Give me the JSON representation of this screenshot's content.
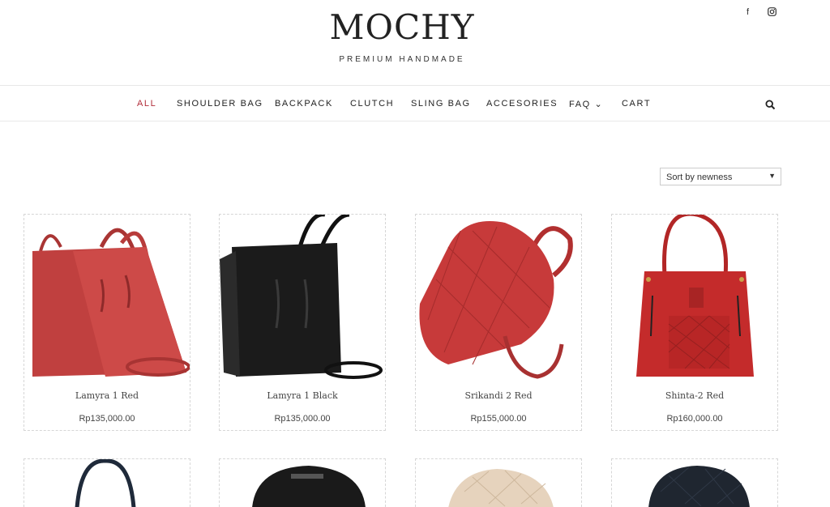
{
  "brand": {
    "name": "MOCHY",
    "tagline": "PREMIUM HANDMADE"
  },
  "social": [
    {
      "icon": "facebook-icon",
      "glyph": "f"
    },
    {
      "icon": "instagram-icon",
      "glyph": "◙"
    }
  ],
  "nav": {
    "items": [
      {
        "label": "ALL",
        "active": true
      },
      {
        "label": "SHOULDER BAG"
      },
      {
        "label": "BACKPACK"
      },
      {
        "label": "CLUTCH"
      },
      {
        "label": "SLING BAG"
      },
      {
        "label": "ACCESORIES"
      },
      {
        "label": "FAQ ⌄"
      },
      {
        "label": "CART"
      }
    ],
    "search_icon": "search-icon"
  },
  "sort": {
    "selected": "Sort by newness"
  },
  "products": [
    {
      "name": "Lamyra 1 Red",
      "price": "Rp135,000.00",
      "color": "#c0403f"
    },
    {
      "name": "Lamyra 1 Black",
      "price": "Rp135,000.00",
      "color": "#1b1b1b"
    },
    {
      "name": "Srikandi 2 Red",
      "price": "Rp155,000.00",
      "color": "#c73a3a"
    },
    {
      "name": "Shinta-2 Red",
      "price": "Rp160,000.00",
      "color": "#c42b2b"
    }
  ],
  "products_row2_colors": [
    "#1f2a3a",
    "#1a1a1a",
    "#e6d3bd",
    "#1f2630"
  ],
  "colors": {
    "accent": "#b22d3a",
    "text": "#222222",
    "border": "#e8e8e8"
  }
}
